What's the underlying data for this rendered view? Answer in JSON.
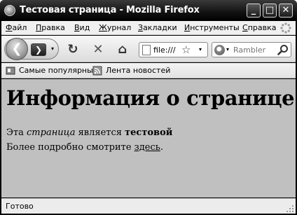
{
  "window": {
    "title": "Тестовая страница - Mozilla Firefox",
    "minimize_glyph": "_",
    "maximize_glyph": "□",
    "close_glyph": "✕"
  },
  "menu": {
    "items": [
      {
        "label": "Файл"
      },
      {
        "label": "Правка"
      },
      {
        "label": "Вид"
      },
      {
        "label": "Журнал"
      },
      {
        "label": "Закладки"
      },
      {
        "label": "Инструменты"
      },
      {
        "label": "Справка"
      }
    ]
  },
  "navbar": {
    "back_glyph": "❮",
    "forward_glyph": "❯",
    "history_glyph": "▾",
    "reload_glyph": "↻",
    "stop_glyph": "✕",
    "home_glyph": "⌂",
    "url_value": "file:///",
    "star_glyph": "☆",
    "url_drop_glyph": "▾",
    "search_engine_drop_glyph": "▾",
    "search_placeholder": "Rambler"
  },
  "bookmarks": {
    "items": [
      {
        "label": "Самые популярные",
        "icon": "bookmark-folder-icon"
      },
      {
        "label": "Лента новостей",
        "icon": "rss-feed-icon"
      }
    ]
  },
  "page": {
    "heading": "Информация о странице",
    "p1_start": "Эта ",
    "p1_em": "страница",
    "p1_mid": " является ",
    "p1_strong": "тестовой",
    "p2_text": "Более подробно смотрите ",
    "p2_link": "здесь",
    "p2_end": "."
  },
  "status": {
    "text": "Готово"
  },
  "colors": {
    "content_bg": "#c0c0c0",
    "titlebar": "#000000"
  }
}
